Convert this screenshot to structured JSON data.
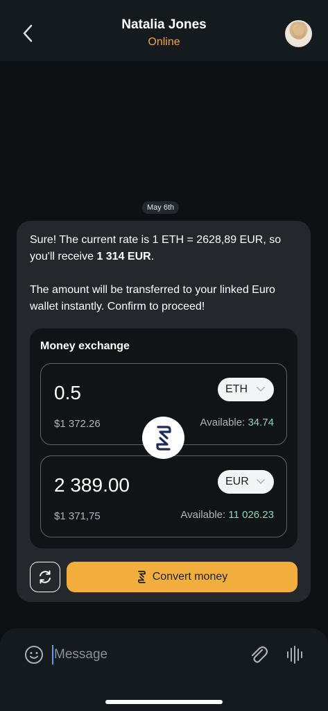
{
  "header": {
    "title": "Natalia Jones",
    "status": "Online"
  },
  "chat": {
    "date_label": "May 6th",
    "message": {
      "line1_prefix": "Sure! The current rate is 1 ETH = 2628,89 EUR, so you'll receive ",
      "line1_bold": "1 314 EUR",
      "line1_suffix": ".",
      "paragraph2": "The amount will be transferred to your linked Euro wallet instantly. Confirm to proceed!"
    },
    "exchange": {
      "title": "Money exchange",
      "from": {
        "amount": "0.5",
        "currency": "ETH",
        "fiat_value": "$1 372.26",
        "available_label": "Available:",
        "available_value": "34.74"
      },
      "to": {
        "amount": "2 389.00",
        "currency": "EUR",
        "fiat_value": "$1 371,75",
        "available_label": "Available:",
        "available_value": "11 026.23"
      }
    },
    "actions": {
      "convert_label": "Convert money"
    }
  },
  "composer": {
    "placeholder": "Message"
  },
  "colors": {
    "accent": "#f2ae3c",
    "status_online": "#f0a53a",
    "available_value": "#8fd3b9",
    "background": "#0e1114",
    "bubble": "#24282d"
  },
  "icons": {
    "back": "chevron-left-icon",
    "swap": "logo-swap-icon",
    "refresh": "refresh-icon",
    "convert": "logo-icon",
    "emoji": "smiley-icon",
    "attach": "paperclip-icon",
    "voice": "waveform-icon"
  }
}
